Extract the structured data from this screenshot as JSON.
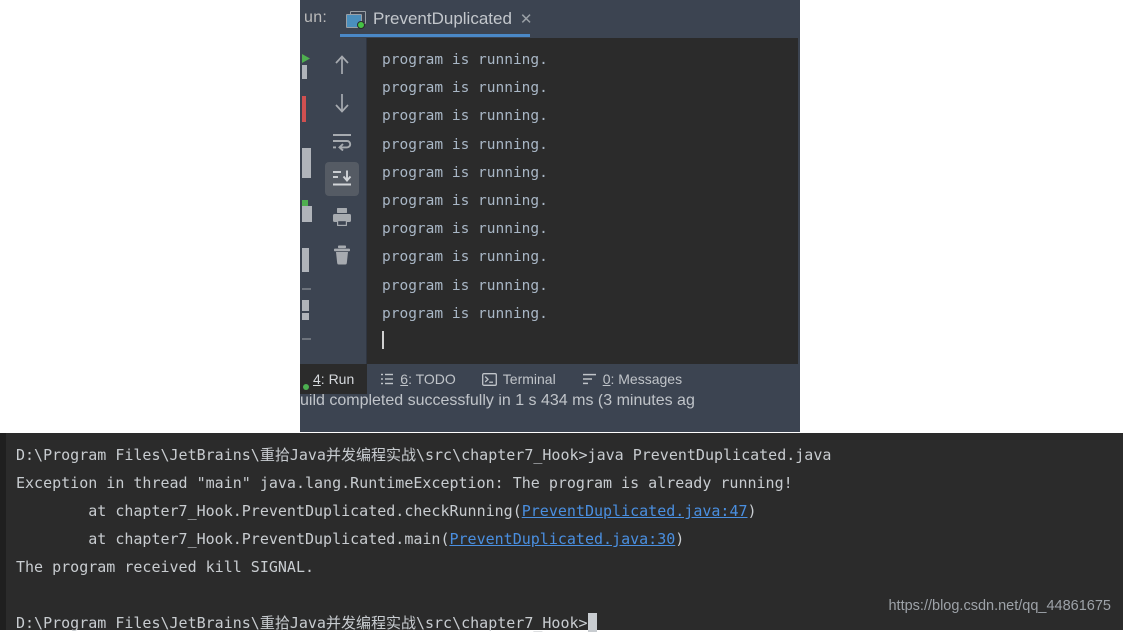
{
  "ide": {
    "run_label": "un:",
    "tab": {
      "title": "PreventDuplicated",
      "icon": "run-configuration-icon",
      "close_icon": "close-icon"
    },
    "toolbar": [
      {
        "name": "up-arrow-icon",
        "label": "Up the stack trace",
        "active": false
      },
      {
        "name": "down-arrow-icon",
        "label": "Down the stack trace",
        "active": false
      },
      {
        "name": "soft-wrap-icon",
        "label": "Soft-Wrap",
        "active": false
      },
      {
        "name": "scroll-to-end-icon",
        "label": "Scroll to the end",
        "active": true
      },
      {
        "name": "print-icon",
        "label": "Print",
        "active": false
      },
      {
        "name": "trash-icon",
        "label": "Clear All",
        "active": false
      }
    ],
    "console_lines": [
      "program is running.",
      "program is running.",
      "program is running.",
      "program is running.",
      "program is running.",
      "program is running.",
      "program is running.",
      "program is running.",
      "program is running.",
      "program is running."
    ],
    "tool_windows": [
      {
        "num": "4",
        "label": ": Run",
        "icon": "run-icon",
        "selected": true
      },
      {
        "num": "6",
        "label": ": TODO",
        "icon": "todo-list-icon",
        "selected": false
      },
      {
        "num": "",
        "label": "Terminal",
        "icon": "terminal-icon",
        "selected": false
      },
      {
        "num": "0",
        "label": ": Messages",
        "icon": "messages-icon",
        "selected": false
      }
    ],
    "status_text": "uild completed successfully in 1 s 434 ms (3 minutes ag"
  },
  "terminal": {
    "prompt_path": "D:\\Program Files\\JetBrains\\重拾Java并发编程实战\\src\\chapter7_Hook>",
    "command": "java PreventDuplicated.java",
    "exception_line": "Exception in thread \"main\" java.lang.RuntimeException: The program is already running!",
    "stack": [
      {
        "prefix": "        at chapter7_Hook.PreventDuplicated.checkRunning(",
        "link": "PreventDuplicated.java:47",
        "suffix": ")"
      },
      {
        "prefix": "        at chapter7_Hook.PreventDuplicated.main(",
        "link": "PreventDuplicated.java:30",
        "suffix": ")"
      }
    ],
    "kill_line": "The program received kill SIGNAL.",
    "final_prompt": "D:\\Program Files\\JetBrains\\重拾Java并发编程实战\\src\\chapter7_Hook>"
  },
  "watermark": "https://blog.csdn.net/qq_44861675",
  "colors": {
    "panel_bg": "#3c4451",
    "console_bg": "#2b2b2b",
    "console_text": "#a9b7c6",
    "tab_underline": "#4a88c7",
    "link": "#4a8fe0",
    "run_green": "#4caf50"
  }
}
